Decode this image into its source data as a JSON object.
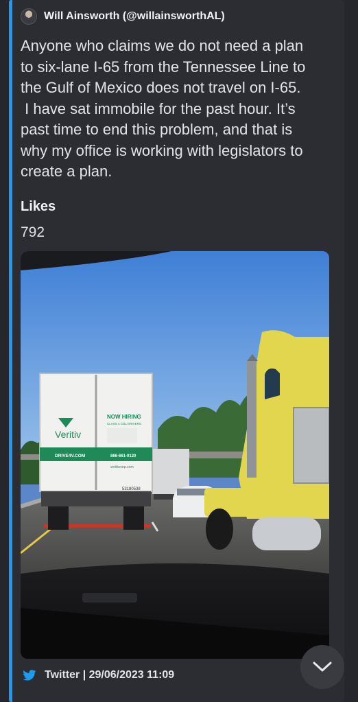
{
  "author": {
    "name": "Will Ainsworth (@willainsworthAL)"
  },
  "tweet": {
    "lines": [
      "Anyone who claims we do not need a plan",
      "to six-lane I-65 from the Tennessee Line to",
      "the Gulf of Mexico does not travel on I-65.",
      " I have sat immobile for the past hour. It’s",
      "past time to end this problem, and that is",
      "why my office is working with legislators to",
      "create a plan."
    ]
  },
  "fields": {
    "likes_label": "Likes",
    "likes_value": "792"
  },
  "photo": {
    "truck_brand": "Veritiv",
    "truck_hiring": "NOW HIRING",
    "truck_hiring_sub": "CLASS A CDL DRIVERS",
    "truck_url": "DRIVE4V.COM",
    "truck_phone": "866-661-0120",
    "truck_site": "veritivcorp.com",
    "truck_unit": "53180538"
  },
  "footer": {
    "text": "Twitter | 29/06/2023 11:09"
  },
  "icons": {
    "twitter": "twitter-bird-icon",
    "scroll": "chevron-down-icon"
  },
  "colors": {
    "accent": "#1d9bf0",
    "background": "#26272c",
    "embed": "#2c2d32"
  }
}
